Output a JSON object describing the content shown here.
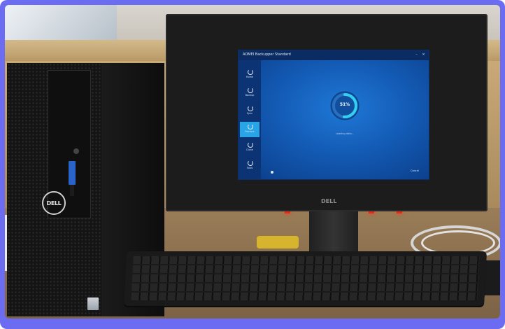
{
  "scene": {
    "description_objects": [
      "desktop-tower",
      "monitor",
      "keyboard"
    ]
  },
  "tower": {
    "brand_logo": "DELL"
  },
  "monitor": {
    "brand_logo": "DELL"
  },
  "app_window": {
    "title": "AOMEI Backupper Standard",
    "sidebar": [
      {
        "label": "Home",
        "active": false
      },
      {
        "label": "Backup",
        "active": false
      },
      {
        "label": "Sync",
        "active": false
      },
      {
        "label": "Restore",
        "active": true
      },
      {
        "label": "Clone",
        "active": false
      },
      {
        "label": "Tools",
        "active": false
      }
    ],
    "progress_percent_text": "51%",
    "progress_fraction": 0.51,
    "status_text": "Loading data...",
    "cancel_label": "Cancel"
  },
  "colors": {
    "frame": "#6b6cf2",
    "app_accent": "#28a5e6"
  }
}
